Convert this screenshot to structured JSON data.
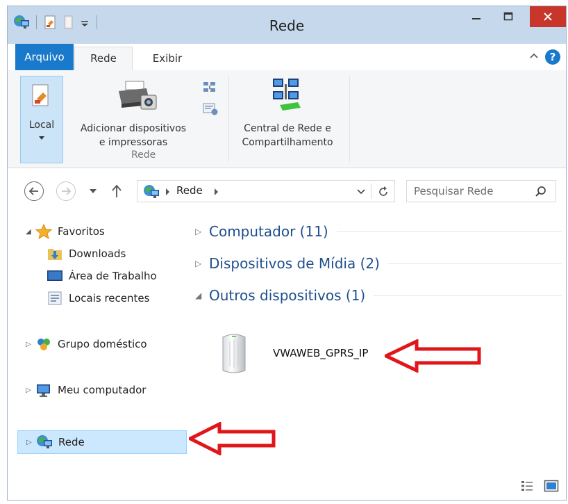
{
  "window": {
    "title": "Rede"
  },
  "ribbon": {
    "tabs": {
      "file": "Arquivo",
      "rede": "Rede",
      "exibir": "Exibir"
    },
    "help": "?",
    "local": {
      "label": "Local"
    },
    "add_devices": {
      "line1": "Adicionar dispositivos",
      "line2": "e impressoras"
    },
    "group_rede": "Rede",
    "network_center": {
      "line1": "Central de Rede e",
      "line2": "Compartilhamento"
    }
  },
  "address": {
    "path": "Rede",
    "search_placeholder": "Pesquisar Rede"
  },
  "nav": {
    "favoritos": "Favoritos",
    "downloads": "Downloads",
    "desktop": "Área de Trabalho",
    "recent": "Locais recentes",
    "homegroup": "Grupo doméstico",
    "computer": "Meu computador",
    "network": "Rede"
  },
  "groups": [
    {
      "label": "Computador (11)",
      "expanded": false
    },
    {
      "label": "Dispositivos de Mídia (2)",
      "expanded": false
    },
    {
      "label": "Outros dispositivos (1)",
      "expanded": true
    }
  ],
  "device": {
    "name": "VWAWEB_GPRS_IP"
  },
  "colors": {
    "accent": "#1979ca",
    "annotation_arrow": "#e0161b",
    "group_text": "#1e4e8c"
  }
}
